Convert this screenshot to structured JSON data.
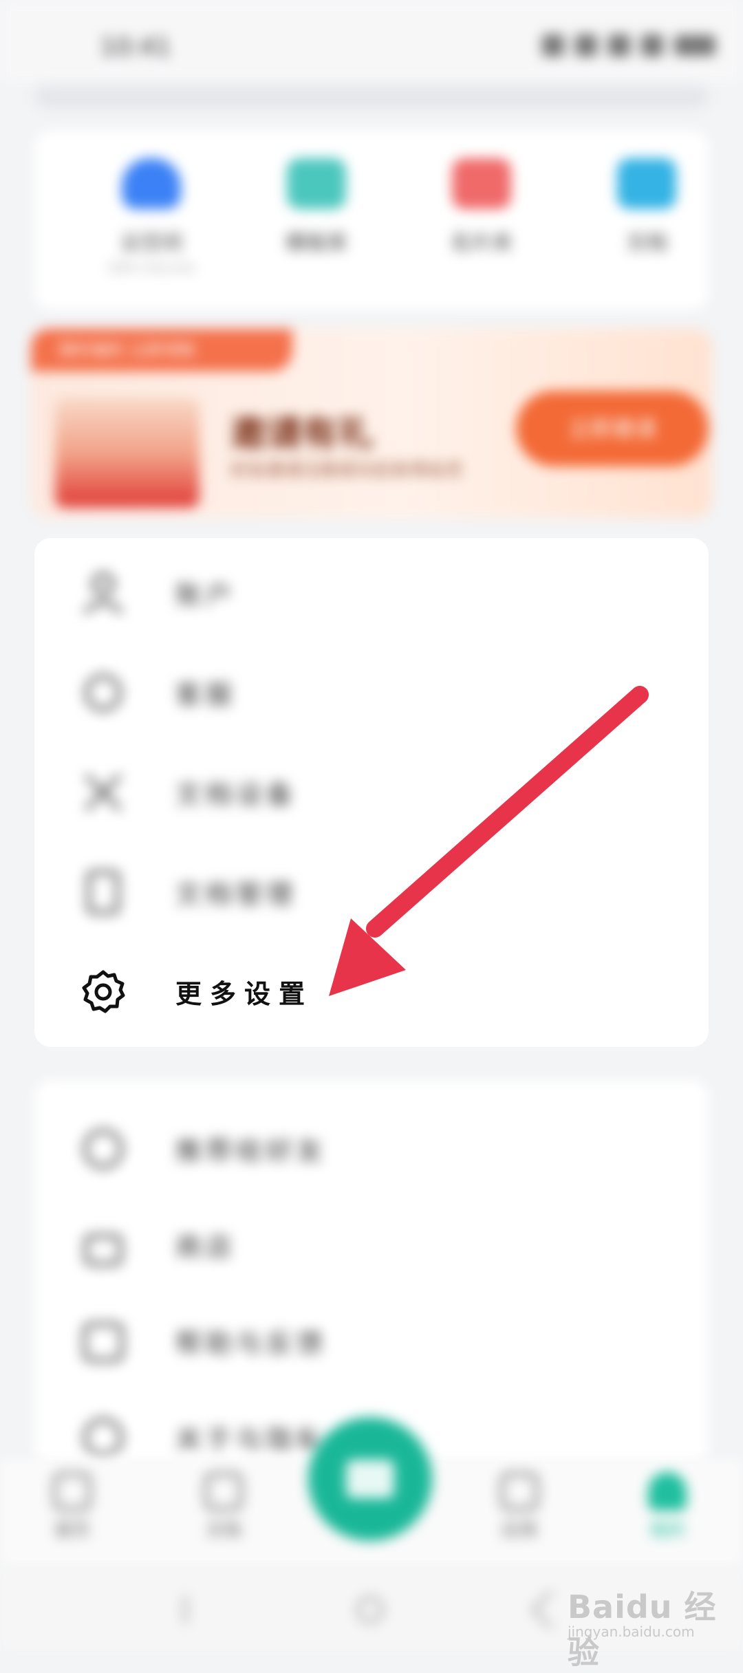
{
  "status_bar": {
    "time": "10:41"
  },
  "quick_tools": [
    {
      "label": "云空间",
      "sub": "已用 4.9G/10G",
      "color": "#3c82f6",
      "icon": "cloud-icon"
    },
    {
      "label": "模板库",
      "color": "#4cc7be",
      "icon": "template-icon"
    },
    {
      "label": "名片夹",
      "color": "#f06a6a",
      "icon": "card-icon"
    },
    {
      "label": "文档",
      "color": "#34b3e4",
      "icon": "doc-icon"
    }
  ],
  "promo": {
    "tag": "限时福利 立即领取",
    "title": "邀请有礼",
    "subtitle": "好友邀请注册成功后各得会员",
    "button": "立即邀请"
  },
  "menu": [
    {
      "label": "账户",
      "icon": "user-icon"
    },
    {
      "label": "客服",
      "icon": "headset-icon"
    },
    {
      "label": "文档设备",
      "icon": "device-icon"
    },
    {
      "label": "文档管理",
      "icon": "file-icon"
    },
    {
      "label": "更多设置",
      "icon": "gear-icon"
    }
  ],
  "menu2": [
    {
      "label": "推荐给好友",
      "icon": "share-icon"
    },
    {
      "label": "商店",
      "icon": "shop-icon"
    },
    {
      "label": "帮助与反馈",
      "icon": "help-icon"
    },
    {
      "label": "关于与隐私",
      "icon": "info-icon"
    }
  ],
  "bottom_nav": [
    {
      "label": "首页",
      "icon": "home-icon"
    },
    {
      "label": "文档",
      "icon": "doc-nav-icon"
    },
    {
      "label": "应用",
      "icon": "apps-icon"
    },
    {
      "label": "我的",
      "icon": "profile-icon"
    }
  ],
  "annotation": {
    "arrow_color": "#e8344a"
  },
  "watermark": {
    "main": "Baidu 经验",
    "url": "jingyan.baidu.com"
  }
}
